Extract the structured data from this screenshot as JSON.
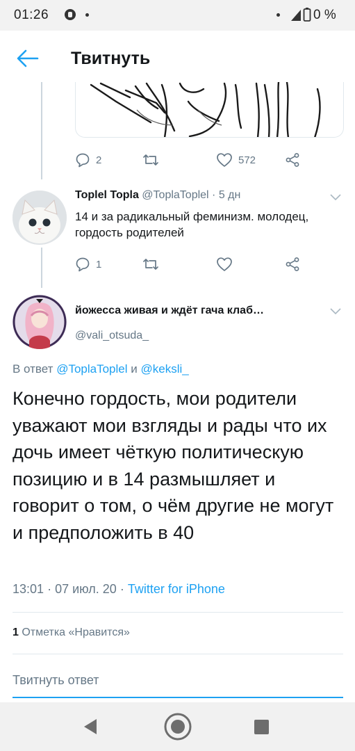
{
  "status_bar": {
    "time": "01:26",
    "battery": "0 %"
  },
  "app_bar": {
    "title": "Твитнуть",
    "back_icon": "arrow-left-icon",
    "accent_color": "#1da1f2"
  },
  "parent_tweet": {
    "image_icon": "sketch-drawing",
    "actions": {
      "reply_count": "2",
      "retweet_count": "",
      "like_count": "572"
    }
  },
  "reply_tweet": {
    "name": "Toplel Topla",
    "handle": "@ToplaToplel",
    "time": "5 дн",
    "text": "14 и за радикальный феминизм. молодец, гордость родителей",
    "actions": {
      "reply_count": "1",
      "retweet_count": "",
      "like_count": ""
    }
  },
  "main_tweet": {
    "name": "йожесса живая и ждёт гача клаб…",
    "handle": "@vali_otsuda_",
    "reply_prefix": "В ответ",
    "reply_user1": "@ToplaToplel",
    "reply_and": "и",
    "reply_user2": "@keksli_",
    "text": "Конечно гордость, мои родители уважают мои взгляды и рады что их дочь имеет чёткую политическую позицию и в 14 размышляет и говорит о том, о чём другие не могут и предположить в 40",
    "time": "13:01",
    "date": "07 июл. 20",
    "source": "Twitter for iPhone",
    "likes_count": "1",
    "likes_label": "Отметка «Нравится»"
  },
  "reply_input": {
    "placeholder": "Твитнуть ответ"
  },
  "nav_bar": {
    "back": "nav-back-icon",
    "home": "nav-home-icon",
    "recent": "nav-recent-icon"
  }
}
